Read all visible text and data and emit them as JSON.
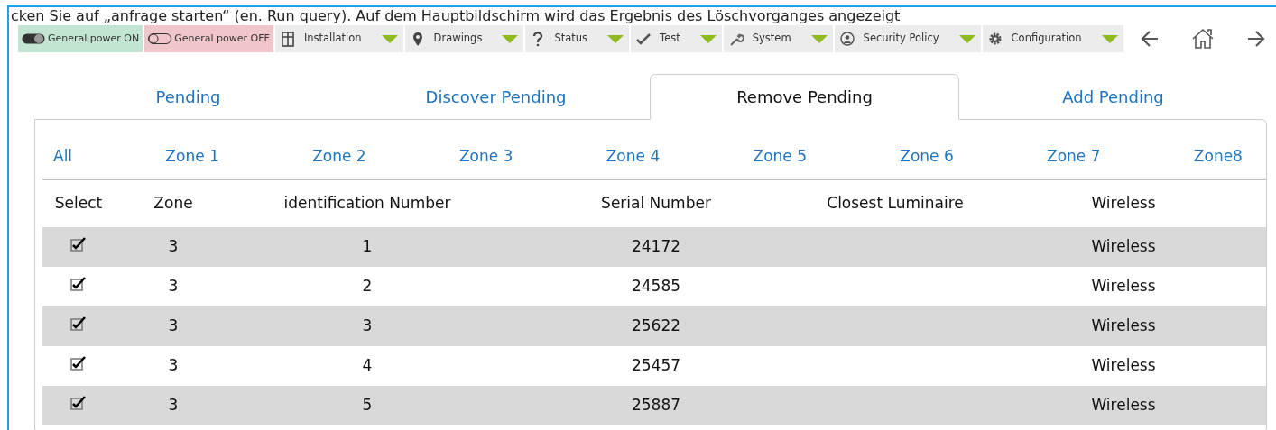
{
  "caption": "cken Sie auf „anfrage starten“ (en. Run query). Auf dem Hauptbildschirm wird das Ergebnis des Löschvorganges angezeigt",
  "power": [
    {
      "label": "General power ON",
      "on": true
    },
    {
      "label": "General power OFF",
      "on": false
    }
  ],
  "menus": [
    {
      "label": "Installation"
    },
    {
      "label": "Drawings"
    },
    {
      "label": "Status"
    },
    {
      "label": "Test"
    },
    {
      "label": "System"
    },
    {
      "label": "Security Policy"
    },
    {
      "label": "Configuration"
    }
  ],
  "tabs": [
    {
      "label": "Pending",
      "selected": false
    },
    {
      "label": "Discover Pending",
      "selected": false
    },
    {
      "label": "Remove Pending",
      "selected": true
    },
    {
      "label": "Add Pending",
      "selected": false
    }
  ],
  "zones": [
    "All",
    "Zone 1",
    "Zone 2",
    "Zone 3",
    "Zone 4",
    "Zone 5",
    "Zone 6",
    "Zone 7",
    "Zone8"
  ],
  "table": {
    "columns": [
      "Select",
      "Zone",
      "identification Number",
      "Serial Number",
      "Closest Luminaire",
      "Wireless"
    ],
    "rows": [
      {
        "checked": true,
        "zone": "3",
        "id": "1",
        "serial": "24172",
        "wireless": "Wireless"
      },
      {
        "checked": true,
        "zone": "3",
        "id": "2",
        "serial": "24585",
        "wireless": "Wireless"
      },
      {
        "checked": true,
        "zone": "3",
        "id": "3",
        "serial": "25622",
        "wireless": "Wireless"
      },
      {
        "checked": true,
        "zone": "3",
        "id": "4",
        "serial": "25457",
        "wireless": "Wireless"
      },
      {
        "checked": true,
        "zone": "3",
        "id": "5",
        "serial": "25887",
        "wireless": "Wireless"
      }
    ]
  }
}
